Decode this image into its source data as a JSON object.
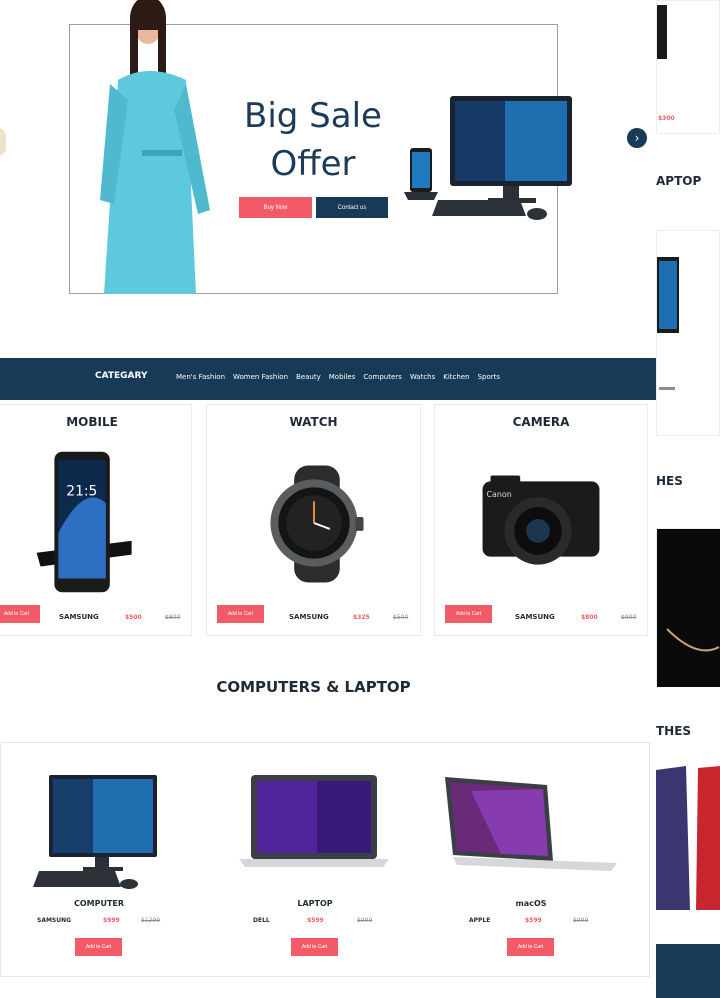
{
  "hero": {
    "title_line1": "Big Sale",
    "title_line2": "Offer",
    "buy_now_label": "Buy Now",
    "contact_label": "Contact us",
    "next_icon": "chevron-right-icon"
  },
  "category_bar": {
    "title": "CATEGARY",
    "items": [
      "Men's Fashion",
      "Women Fashion",
      "Beauty",
      "Mobiles",
      "Computers",
      "Watchs",
      "Kitchen",
      "Sports"
    ]
  },
  "products": [
    {
      "title": "MOBILE",
      "cart_label": "Add to Cart",
      "brand": "SAMSUNG",
      "price": "$500",
      "old_price": "$800"
    },
    {
      "title": "WATCH",
      "cart_label": "Add to Cart",
      "brand": "SAMSUNG",
      "price": "$325",
      "old_price": "$500"
    },
    {
      "title": "CAMERA",
      "cart_label": "Add to Cart",
      "brand": "SAMSUNG",
      "price": "$800",
      "old_price": "$900"
    }
  ],
  "computers": {
    "section_title": "COMPUTERS & LAPTOP",
    "items": [
      {
        "name": "COMPUTER",
        "brand": "SAMSUNG",
        "price": "$999",
        "old_price": "$1299",
        "cart_label": "Add to Cart"
      },
      {
        "name": "LAPTOP",
        "brand": "DELL",
        "price": "$599",
        "old_price": "$999",
        "cart_label": "Add to Cart"
      },
      {
        "name": "macOS",
        "brand": "APPLE",
        "price": "$599",
        "old_price": "$999",
        "cart_label": "Add to Cart"
      }
    ]
  },
  "side": {
    "heading_laptop": "APTOP",
    "heading_clothes1": "HES",
    "heading_clothes2": "THES",
    "price_1": "$300"
  },
  "colors": {
    "navy": "#173a57",
    "accent": "#f35a68"
  }
}
